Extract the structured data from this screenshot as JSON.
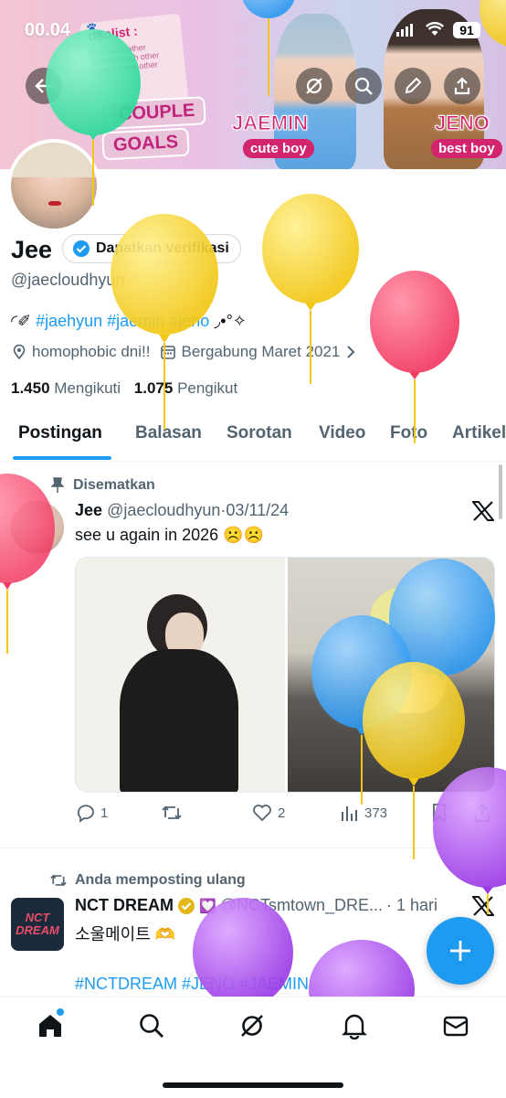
{
  "status_bar": {
    "time": "00.04",
    "battery": "91"
  },
  "banner": {
    "list_title": "doolist :",
    "list_lines": [
      "love each other",
      "support each other",
      "protect each other"
    ],
    "couple_label": "COUPLE",
    "goals_label": "GOALS",
    "name_left": "JAEMIN",
    "sub_left": "cute boy",
    "name_right": "JENO",
    "sub_right": "best boy"
  },
  "profile": {
    "display_name": "Jee",
    "verify_label": "Dapatkan verifikasi",
    "handle": "@jaecloudhyun",
    "bio_prefix": "◜✐",
    "bio_tags": [
      "#jaehyun",
      "#jaemin",
      "#jeno"
    ],
    "bio_suffix": "◞•°✧",
    "location": "homophobic dni!!",
    "joined": "Bergabung Maret 2021",
    "following_count": "1.450",
    "following_label": "Mengikuti",
    "followers_count": "1.075",
    "followers_label": "Pengikut"
  },
  "tabs": [
    "Postingan",
    "Balasan",
    "Sorotan",
    "Video",
    "Foto",
    "Artikel"
  ],
  "pinned_post": {
    "pinned_label": "Disematkan",
    "author": "Jee",
    "handle": "@jaecloudhyun",
    "dot": "·",
    "date": "03/11/24",
    "text": "see u again in 2026 ☹️☹️",
    "replies": "1",
    "retweets": "",
    "likes": "2",
    "views": "373"
  },
  "repost": {
    "repost_label": "Anda memposting ulang",
    "author": "NCT DREAM",
    "handle": "@NCTsmtown_DRE...",
    "time": "· 1 hari",
    "avatar_text": "NCT DREAM",
    "text": "소울메이트 🫶",
    "tags": "#NCTDREAM #JENO #JAEMIN"
  },
  "colors": {
    "accent": "#1d9bf0",
    "text": "#0f1419",
    "muted": "#536471"
  }
}
